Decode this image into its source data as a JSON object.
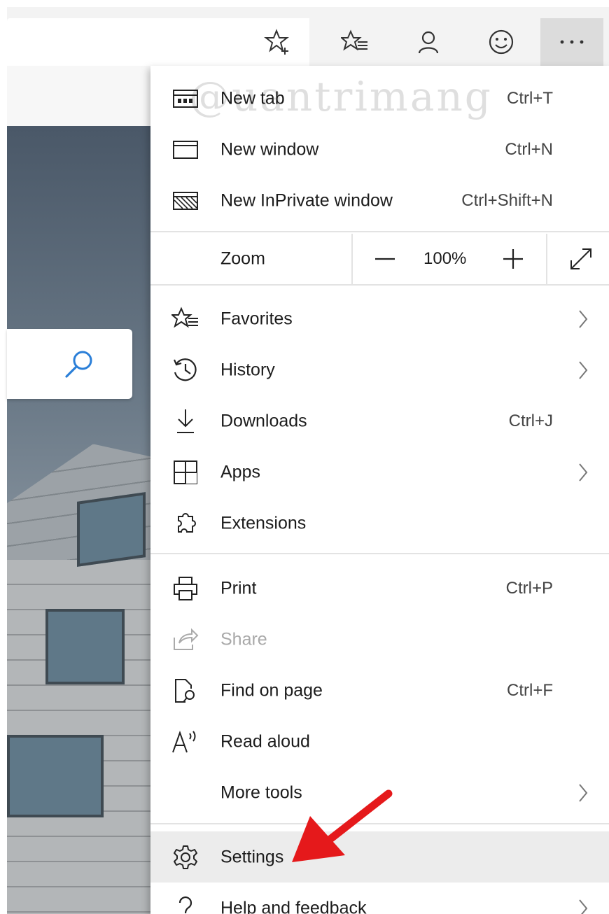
{
  "menu": {
    "items": [
      {
        "label": "New tab",
        "shortcut": "Ctrl+T",
        "icon": "new-tab-icon"
      },
      {
        "label": "New window",
        "shortcut": "Ctrl+N",
        "icon": "window-icon"
      },
      {
        "label": "New InPrivate window",
        "shortcut": "Ctrl+Shift+N",
        "icon": "inprivate-icon"
      },
      {
        "label": "Favorites",
        "shortcut": "",
        "icon": "favorites-icon",
        "submenu": true
      },
      {
        "label": "History",
        "shortcut": "",
        "icon": "history-icon",
        "submenu": true
      },
      {
        "label": "Downloads",
        "shortcut": "Ctrl+J",
        "icon": "download-icon"
      },
      {
        "label": "Apps",
        "shortcut": "",
        "icon": "apps-icon",
        "submenu": true
      },
      {
        "label": "Extensions",
        "shortcut": "",
        "icon": "puzzle-icon"
      },
      {
        "label": "Print",
        "shortcut": "Ctrl+P",
        "icon": "printer-icon"
      },
      {
        "label": "Share",
        "shortcut": "",
        "icon": "share-icon",
        "disabled": true
      },
      {
        "label": "Find on page",
        "shortcut": "Ctrl+F",
        "icon": "find-icon"
      },
      {
        "label": "Read aloud",
        "shortcut": "",
        "icon": "read-aloud-icon"
      },
      {
        "label": "More tools",
        "shortcut": "",
        "icon": "",
        "submenu": true
      },
      {
        "label": "Settings",
        "shortcut": "",
        "icon": "gear-icon",
        "highlighted": true
      },
      {
        "label": "Help and feedback",
        "shortcut": "",
        "icon": "help-icon",
        "submenu": true
      }
    ],
    "zoom": {
      "label": "Zoom",
      "value": "100%"
    }
  },
  "toolbar": {
    "icons": [
      "add-favorite-icon",
      "favorites-list-icon",
      "profile-icon",
      "feedback-smiley-icon",
      "more-options-icon"
    ]
  },
  "watermark": "@uantrimang",
  "colors": {
    "arrow": "#e5191b",
    "hover": "#ececec",
    "search_icon": "#2b7fd8"
  }
}
